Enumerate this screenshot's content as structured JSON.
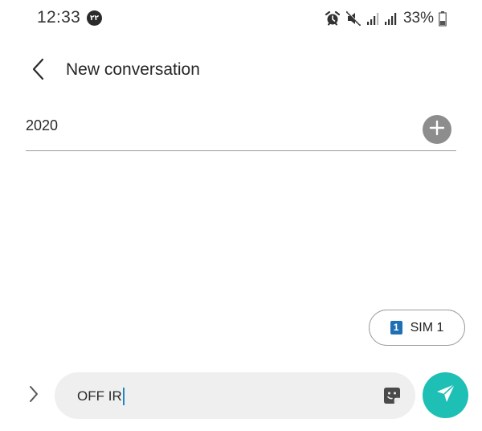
{
  "status_bar": {
    "time": "12:33",
    "notification_badge": "۲۲",
    "battery_percent": "33%",
    "icons": [
      "alarm-icon",
      "mute-icon",
      "signal-1-icon",
      "signal-2-icon",
      "battery-icon"
    ]
  },
  "header": {
    "back_icon": "chevron-left-icon",
    "title": "New conversation"
  },
  "recipient": {
    "value": "2020",
    "add_icon": "plus-icon"
  },
  "sim": {
    "badge": "1",
    "label": "SIM 1",
    "color": "#1f6fb5"
  },
  "composer": {
    "expand_icon": "chevron-right-icon",
    "message": "OFF IR",
    "sticker_icon": "sticker-icon",
    "send_icon": "send-icon",
    "send_color": "#1ebfb5"
  }
}
